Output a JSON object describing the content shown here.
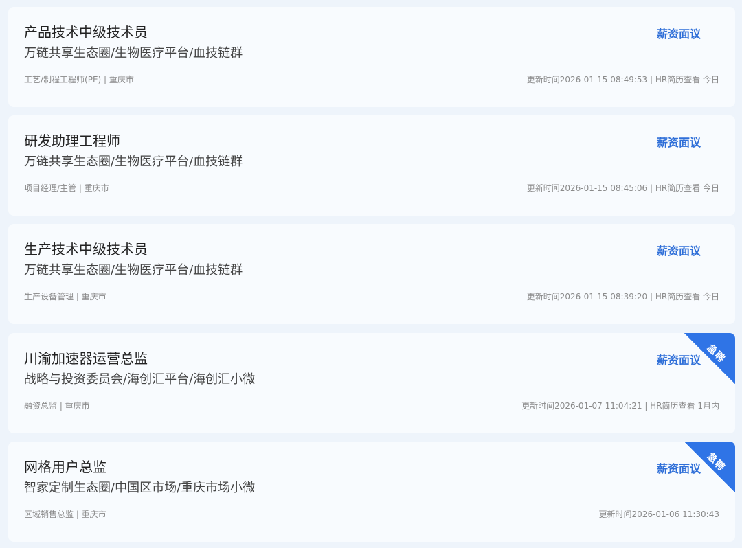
{
  "jobs": [
    {
      "title": "产品技术中级技术员",
      "company": "万链共享生态圈/生物医疗平台/血技链群",
      "meta": "工艺/制程工程师(PE) | 重庆市",
      "salary": "薪资面议",
      "update": "更新时间2026-01-15 08:49:53 | HR简历查看 今日",
      "urgent": false
    },
    {
      "title": "研发助理工程师",
      "company": "万链共享生态圈/生物医疗平台/血技链群",
      "meta": "项目经理/主管 | 重庆市",
      "salary": "薪资面议",
      "update": "更新时间2026-01-15 08:45:06 | HR简历查看 今日",
      "urgent": false
    },
    {
      "title": "生产技术中级技术员",
      "company": "万链共享生态圈/生物医疗平台/血技链群",
      "meta": "生产设备管理 | 重庆市",
      "salary": "薪资面议",
      "update": "更新时间2026-01-15 08:39:20 | HR简历查看 今日",
      "urgent": false
    },
    {
      "title": "川渝加速器运营总监",
      "company": "战略与投资委员会/海创汇平台/海创汇小微",
      "meta": "融资总监 | 重庆市",
      "salary": "薪资面议",
      "update": "更新时间2026-01-07 11:04:21 | HR简历查看 1月内",
      "urgent": true,
      "urgent_label": "急聘"
    },
    {
      "title": "网格用户总监",
      "company": "智家定制生态圈/中国区市场/重庆市场小微",
      "meta": "区域销售总监 | 重庆市",
      "salary": "薪资面议",
      "update": "更新时间2026-01-06 11:30:43",
      "urgent": true,
      "urgent_label": "急聘"
    }
  ],
  "colors": {
    "page_background": "#eef4fb",
    "card_background": "#f8fbfe",
    "salary": "#2f6fd8",
    "ribbon": "#2f74e6"
  }
}
